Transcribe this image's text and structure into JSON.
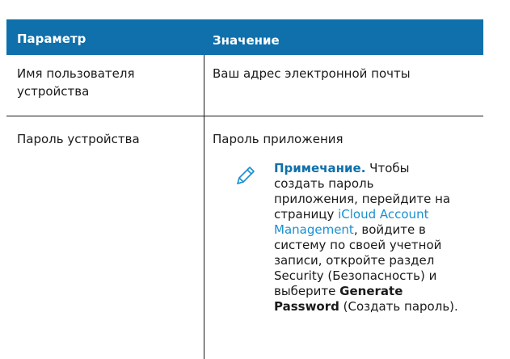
{
  "table": {
    "header": {
      "param": "Параметр",
      "value": "Значение"
    },
    "row1": {
      "param": "Имя пользователя устройства",
      "value": "Ваш адрес электронной почты"
    },
    "row2": {
      "param": "Пароль устройства",
      "value": "Пароль приложения",
      "note": {
        "label": "Примечание.",
        "part1": " Чтобы создать пароль приложения, перейдите на страницу ",
        "link": "iCloud Account Management",
        "part2": ", войдите в систему по своей учетной записи, откройте раздел Security (Безопасность) и выберите ",
        "bold": "Generate Password",
        "part3": " (Создать пароль)."
      }
    }
  },
  "icons": {
    "note_icon": "pencil-icon"
  },
  "colors": {
    "header_bg": "#0f70ab",
    "link": "#1a8fd0",
    "note_label": "#0f70ab"
  }
}
